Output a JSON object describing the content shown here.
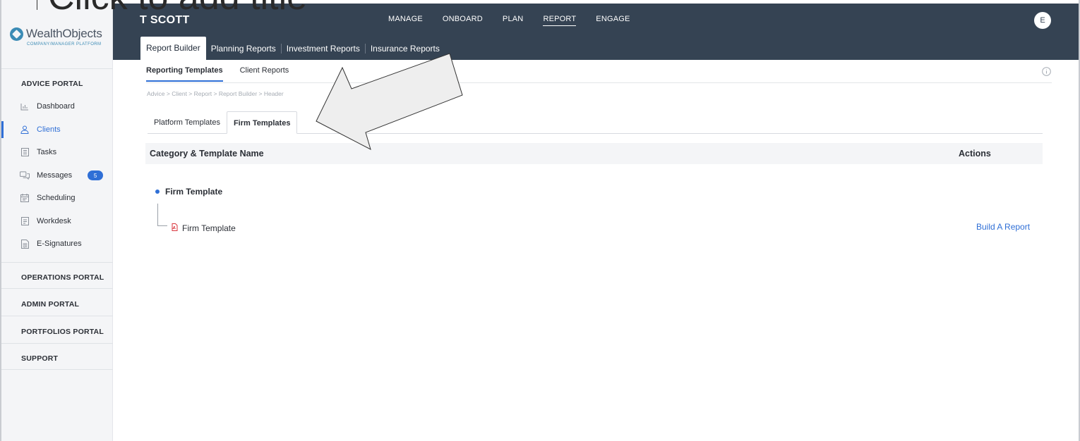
{
  "slide": {
    "title": "Click to add title"
  },
  "logo": {
    "name": "WealthObjects",
    "tagline": "COMPANY/MANAGER PLATFORM"
  },
  "sidebar": {
    "portals": [
      {
        "label": "ADVICE PORTAL"
      },
      {
        "label": "OPERATIONS PORTAL"
      },
      {
        "label": "ADMIN PORTAL"
      },
      {
        "label": "PORTFOLIOS PORTAL"
      },
      {
        "label": "SUPPORT"
      }
    ],
    "items": [
      {
        "label": "Dashboard",
        "icon": "bar-chart-icon"
      },
      {
        "label": "Clients",
        "icon": "user-icon",
        "active": true
      },
      {
        "label": "Tasks",
        "icon": "list-icon"
      },
      {
        "label": "Messages",
        "icon": "chat-icon",
        "badge": "5"
      },
      {
        "label": "Scheduling",
        "icon": "calendar-icon"
      },
      {
        "label": "Workdesk",
        "icon": "document-icon"
      },
      {
        "label": "E-Signatures",
        "icon": "signature-icon"
      }
    ]
  },
  "header": {
    "client_name": "T SCOTT",
    "nav": [
      "MANAGE",
      "ONBOARD",
      "PLAN",
      "REPORT",
      "ENGAGE"
    ],
    "active_nav": "REPORT",
    "avatar_initial": "E",
    "subtabs": [
      "Report Builder",
      "Planning Reports",
      "Investment Reports",
      "Insurance Reports"
    ]
  },
  "main": {
    "tabs": [
      "Reporting Templates",
      "Client Reports"
    ],
    "breadcrumb": "Advice  >  Client  >  Report  >  Report Builder  >  Header",
    "template_tabs": [
      "Platform Templates",
      "Firm Templates"
    ],
    "table": {
      "col_name": "Category & Template Name",
      "col_actions": "Actions"
    },
    "category": "Firm Template",
    "template": "Firm Template",
    "action_label": "Build A Report"
  },
  "colors": {
    "accent": "#2f6fd6",
    "header_bg": "#354353",
    "pdf_icon": "#d9363e"
  }
}
